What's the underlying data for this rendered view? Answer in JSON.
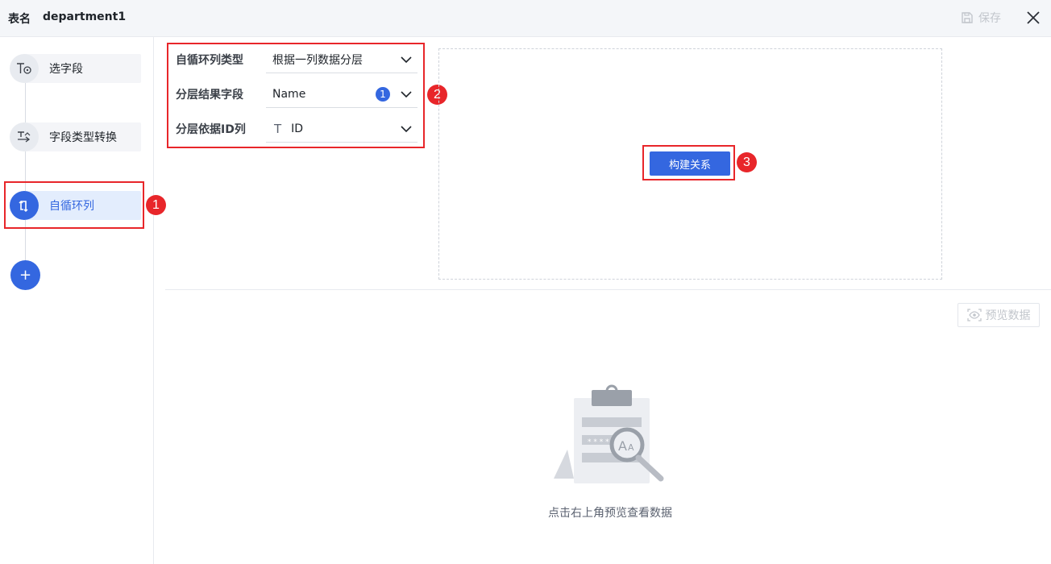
{
  "topbar": {
    "table_label": "表名",
    "table_name": "department1",
    "save_label": "保存",
    "save_icon": "save-icon",
    "close_icon": "close-icon"
  },
  "steps": [
    {
      "label": "选字段",
      "icon": "select-field-icon",
      "active": false
    },
    {
      "label": "字段类型转换",
      "icon": "type-convert-icon",
      "active": false
    },
    {
      "label": "自循环列",
      "icon": "self-loop-icon",
      "active": true
    }
  ],
  "add_icon": "+",
  "form": {
    "type_label": "自循环列类型",
    "type_value": "根据一列数据分层",
    "result_label": "分层结果字段",
    "result_value": "Name",
    "result_count": "1",
    "id_label": "分层依据ID列",
    "id_type_icon": "T",
    "id_value": "ID"
  },
  "build_button": "构建关系",
  "preview_button": "预览数据",
  "empty_text": "点击右上角预览查看数据",
  "annotations": [
    "1",
    "2",
    "3"
  ],
  "colors": {
    "accent": "#3467e0",
    "annotation": "#e8262a"
  }
}
